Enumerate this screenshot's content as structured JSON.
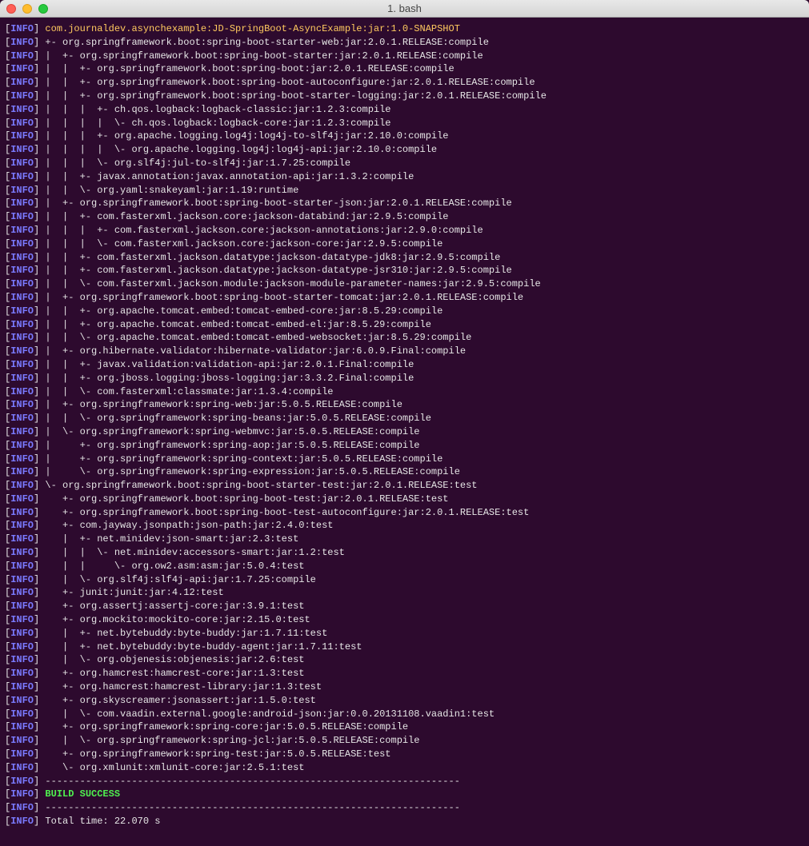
{
  "window": {
    "title": "1. bash"
  },
  "tag": "INFO",
  "lines": [
    {
      "t": "y",
      "s": "com.journaldev.asynchexample:JD-SpringBoot-AsyncExample:jar:1.0-SNAPSHOT"
    },
    {
      "t": "w",
      "s": "+- org.springframework.boot:spring-boot-starter-web:jar:2.0.1.RELEASE:compile"
    },
    {
      "t": "w",
      "s": "|  +- org.springframework.boot:spring-boot-starter:jar:2.0.1.RELEASE:compile"
    },
    {
      "t": "w",
      "s": "|  |  +- org.springframework.boot:spring-boot:jar:2.0.1.RELEASE:compile"
    },
    {
      "t": "w",
      "s": "|  |  +- org.springframework.boot:spring-boot-autoconfigure:jar:2.0.1.RELEASE:compile"
    },
    {
      "t": "w",
      "s": "|  |  +- org.springframework.boot:spring-boot-starter-logging:jar:2.0.1.RELEASE:compile"
    },
    {
      "t": "w",
      "s": "|  |  |  +- ch.qos.logback:logback-classic:jar:1.2.3:compile"
    },
    {
      "t": "w",
      "s": "|  |  |  |  \\- ch.qos.logback:logback-core:jar:1.2.3:compile"
    },
    {
      "t": "w",
      "s": "|  |  |  +- org.apache.logging.log4j:log4j-to-slf4j:jar:2.10.0:compile"
    },
    {
      "t": "w",
      "s": "|  |  |  |  \\- org.apache.logging.log4j:log4j-api:jar:2.10.0:compile"
    },
    {
      "t": "w",
      "s": "|  |  |  \\- org.slf4j:jul-to-slf4j:jar:1.7.25:compile"
    },
    {
      "t": "w",
      "s": "|  |  +- javax.annotation:javax.annotation-api:jar:1.3.2:compile"
    },
    {
      "t": "w",
      "s": "|  |  \\- org.yaml:snakeyaml:jar:1.19:runtime"
    },
    {
      "t": "w",
      "s": "|  +- org.springframework.boot:spring-boot-starter-json:jar:2.0.1.RELEASE:compile"
    },
    {
      "t": "w",
      "s": "|  |  +- com.fasterxml.jackson.core:jackson-databind:jar:2.9.5:compile"
    },
    {
      "t": "w",
      "s": "|  |  |  +- com.fasterxml.jackson.core:jackson-annotations:jar:2.9.0:compile"
    },
    {
      "t": "w",
      "s": "|  |  |  \\- com.fasterxml.jackson.core:jackson-core:jar:2.9.5:compile"
    },
    {
      "t": "w",
      "s": "|  |  +- com.fasterxml.jackson.datatype:jackson-datatype-jdk8:jar:2.9.5:compile"
    },
    {
      "t": "w",
      "s": "|  |  +- com.fasterxml.jackson.datatype:jackson-datatype-jsr310:jar:2.9.5:compile"
    },
    {
      "t": "w",
      "s": "|  |  \\- com.fasterxml.jackson.module:jackson-module-parameter-names:jar:2.9.5:compile"
    },
    {
      "t": "w",
      "s": "|  +- org.springframework.boot:spring-boot-starter-tomcat:jar:2.0.1.RELEASE:compile"
    },
    {
      "t": "w",
      "s": "|  |  +- org.apache.tomcat.embed:tomcat-embed-core:jar:8.5.29:compile"
    },
    {
      "t": "w",
      "s": "|  |  +- org.apache.tomcat.embed:tomcat-embed-el:jar:8.5.29:compile"
    },
    {
      "t": "w",
      "s": "|  |  \\- org.apache.tomcat.embed:tomcat-embed-websocket:jar:8.5.29:compile"
    },
    {
      "t": "w",
      "s": "|  +- org.hibernate.validator:hibernate-validator:jar:6.0.9.Final:compile"
    },
    {
      "t": "w",
      "s": "|  |  +- javax.validation:validation-api:jar:2.0.1.Final:compile"
    },
    {
      "t": "w",
      "s": "|  |  +- org.jboss.logging:jboss-logging:jar:3.3.2.Final:compile"
    },
    {
      "t": "w",
      "s": "|  |  \\- com.fasterxml:classmate:jar:1.3.4:compile"
    },
    {
      "t": "w",
      "s": "|  +- org.springframework:spring-web:jar:5.0.5.RELEASE:compile"
    },
    {
      "t": "w",
      "s": "|  |  \\- org.springframework:spring-beans:jar:5.0.5.RELEASE:compile"
    },
    {
      "t": "w",
      "s": "|  \\- org.springframework:spring-webmvc:jar:5.0.5.RELEASE:compile"
    },
    {
      "t": "w",
      "s": "|     +- org.springframework:spring-aop:jar:5.0.5.RELEASE:compile"
    },
    {
      "t": "w",
      "s": "|     +- org.springframework:spring-context:jar:5.0.5.RELEASE:compile"
    },
    {
      "t": "w",
      "s": "|     \\- org.springframework:spring-expression:jar:5.0.5.RELEASE:compile"
    },
    {
      "t": "w",
      "s": "\\- org.springframework.boot:spring-boot-starter-test:jar:2.0.1.RELEASE:test"
    },
    {
      "t": "w",
      "s": "   +- org.springframework.boot:spring-boot-test:jar:2.0.1.RELEASE:test"
    },
    {
      "t": "w",
      "s": "   +- org.springframework.boot:spring-boot-test-autoconfigure:jar:2.0.1.RELEASE:test"
    },
    {
      "t": "w",
      "s": "   +- com.jayway.jsonpath:json-path:jar:2.4.0:test"
    },
    {
      "t": "w",
      "s": "   |  +- net.minidev:json-smart:jar:2.3:test"
    },
    {
      "t": "w",
      "s": "   |  |  \\- net.minidev:accessors-smart:jar:1.2:test"
    },
    {
      "t": "w",
      "s": "   |  |     \\- org.ow2.asm:asm:jar:5.0.4:test"
    },
    {
      "t": "w",
      "s": "   |  \\- org.slf4j:slf4j-api:jar:1.7.25:compile"
    },
    {
      "t": "w",
      "s": "   +- junit:junit:jar:4.12:test"
    },
    {
      "t": "w",
      "s": "   +- org.assertj:assertj-core:jar:3.9.1:test"
    },
    {
      "t": "w",
      "s": "   +- org.mockito:mockito-core:jar:2.15.0:test"
    },
    {
      "t": "w",
      "s": "   |  +- net.bytebuddy:byte-buddy:jar:1.7.11:test"
    },
    {
      "t": "w",
      "s": "   |  +- net.bytebuddy:byte-buddy-agent:jar:1.7.11:test"
    },
    {
      "t": "w",
      "s": "   |  \\- org.objenesis:objenesis:jar:2.6:test"
    },
    {
      "t": "w",
      "s": "   +- org.hamcrest:hamcrest-core:jar:1.3:test"
    },
    {
      "t": "w",
      "s": "   +- org.hamcrest:hamcrest-library:jar:1.3:test"
    },
    {
      "t": "w",
      "s": "   +- org.skyscreamer:jsonassert:jar:1.5.0:test"
    },
    {
      "t": "w",
      "s": "   |  \\- com.vaadin.external.google:android-json:jar:0.0.20131108.vaadin1:test"
    },
    {
      "t": "w",
      "s": "   +- org.springframework:spring-core:jar:5.0.5.RELEASE:compile"
    },
    {
      "t": "w",
      "s": "   |  \\- org.springframework:spring-jcl:jar:5.0.5.RELEASE:compile"
    },
    {
      "t": "w",
      "s": "   +- org.springframework:spring-test:jar:5.0.5.RELEASE:test"
    },
    {
      "t": "w",
      "s": "   \\- org.xmlunit:xmlunit-core:jar:2.5.1:test"
    },
    {
      "t": "w",
      "s": "------------------------------------------------------------------------"
    },
    {
      "t": "g",
      "s": "BUILD SUCCESS"
    },
    {
      "t": "w",
      "s": "------------------------------------------------------------------------"
    },
    {
      "t": "w",
      "s": "Total time: 22.070 s"
    }
  ]
}
